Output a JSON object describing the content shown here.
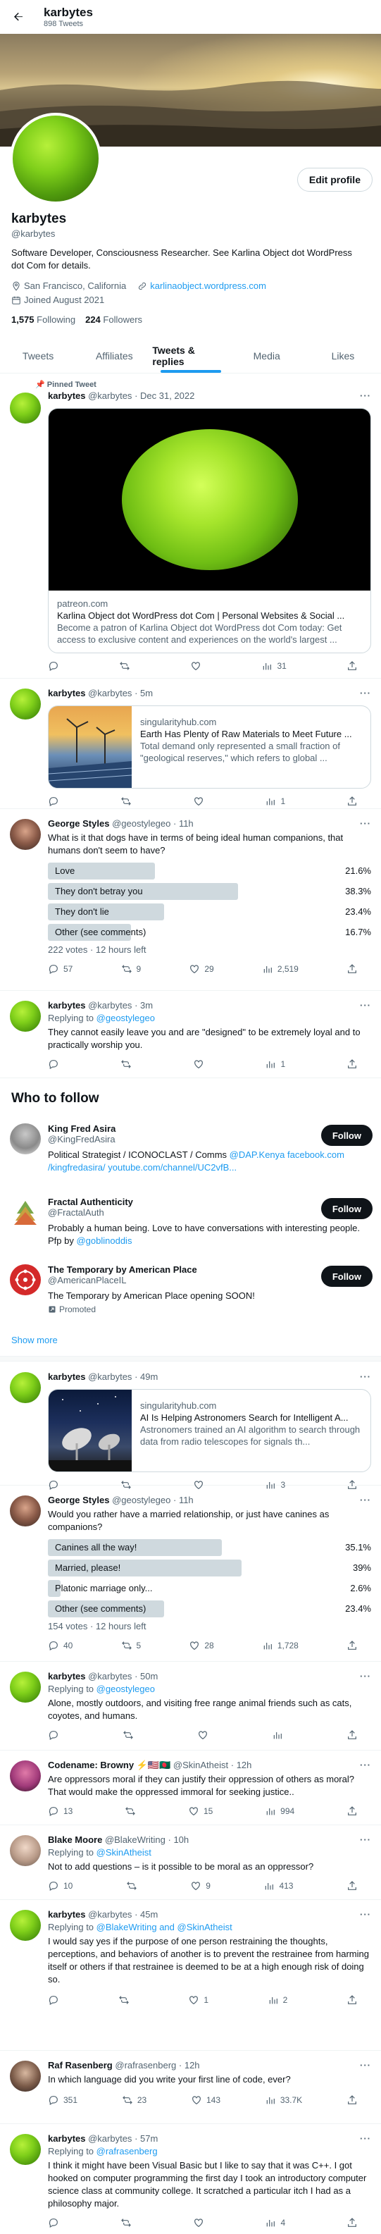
{
  "header": {
    "title": "karbytes",
    "tweet_count": "898 Tweets"
  },
  "profile": {
    "name": "karbytes",
    "handle": "@karbytes",
    "bio": "Software Developer, Consciousness Researcher. See Karlina Object dot WordPress dot Com for details.",
    "location": "San Francisco, California",
    "website": "karlinaobject.wordpress.com",
    "joined": "Joined August 2021",
    "following_count": "1,575",
    "following_label": "Following",
    "followers_count": "224",
    "followers_label": "Followers",
    "edit_label": "Edit profile"
  },
  "tabs": [
    "Tweets",
    "Affiliates",
    "Tweets & replies",
    "Media",
    "Likes"
  ],
  "active_tab": "Tweets & replies",
  "tweets": [
    {
      "pinned_label": "Pinned Tweet",
      "name": "karbytes",
      "handle": "@karbytes",
      "time": "· Dec 31, 2022",
      "card": {
        "domain": "patreon.com",
        "title": "Karlina Object dot WordPress dot Com | Personal Websites & Social ...",
        "desc": "Become a patron of Karlina Object dot WordPress dot Com today: Get access to exclusive content and experiences on the world's largest ..."
      },
      "views": "31"
    },
    {
      "name": "karbytes",
      "handle": "@karbytes",
      "time": "· 5m",
      "card": {
        "domain": "singularityhub.com",
        "title": "Earth Has Plenty of Raw Materials to Meet Future ...",
        "desc": "Total demand only represented a small fraction of \"geological reserves,\" which refers to global ..."
      },
      "likes": "",
      "views": "1"
    },
    {
      "name": "George Styles",
      "handle": "@geostylegeo",
      "time": "· 11h",
      "text": "What is it that dogs have in terms of being ideal human companions, that humans don't seem to have?",
      "poll": [
        {
          "label": "Love",
          "pct": "21.6%",
          "value": 21.6
        },
        {
          "label": "They don't betray you",
          "pct": "38.3%",
          "value": 38.3
        },
        {
          "label": "They don't lie",
          "pct": "23.4%",
          "value": 23.4
        },
        {
          "label": "Other (see comments)",
          "pct": "16.7%",
          "value": 16.7
        }
      ],
      "poll_meta": "222 votes · 12 hours left",
      "replies": "57",
      "retweets": "9",
      "likes": "29",
      "views": "2,519"
    },
    {
      "name": "karbytes",
      "handle": "@karbytes",
      "time": "· 3m",
      "reply_prefix": "Replying to ",
      "reply_to": "@geostylegeo",
      "text": "They cannot easily leave you and are \"designed\" to be extremely loyal and to practically worship you.",
      "views": "1"
    }
  ],
  "who_to_follow": {
    "title": "Who to follow",
    "follow_label": "Follow",
    "show_more": "Show more",
    "items": [
      {
        "name": "King Fred Asira",
        "handle": "@KingFredAsira",
        "bio_pre": "Political Strategist / ICONOCLAST / Comms ",
        "bio_link": "@DAP.Kenya facebook.com /kingfredasira/ youtube.com/channel/UC2vfB..."
      },
      {
        "name": "Fractal Authenticity",
        "handle": "@FractalAuth",
        "bio_pre": "Probably a human being. Love to have conversations with interesting people. Pfp by ",
        "bio_link": "@goblinoddis"
      },
      {
        "name": "The Temporary by American Place",
        "handle": "@AmericanPlaceIL",
        "bio_pre": "The Temporary by American Place opening SOON!",
        "bio_link": "",
        "promoted": "Promoted"
      }
    ]
  },
  "tweets2": [
    {
      "name": "karbytes",
      "handle": "@karbytes",
      "time": "· 49m",
      "card": {
        "domain": "singularityhub.com",
        "title": "AI Is Helping Astronomers Search for Intelligent A...",
        "desc": "Astronomers trained an AI algorithm to search through data from radio telescopes for signals th..."
      },
      "views": "3"
    },
    {
      "name": "George Styles",
      "handle": "@geostylegeo",
      "time": "· 11h",
      "text": "Would you rather have a married relationship, or just have canines as companions?",
      "poll": [
        {
          "label": "Canines all the way!",
          "pct": "35.1%",
          "value": 35.1
        },
        {
          "label": "Married, please!",
          "pct": "39%",
          "value": 39
        },
        {
          "label": "Platonic marriage only...",
          "pct": "2.6%",
          "value": 2.6
        },
        {
          "label": "Other (see comments)",
          "pct": "23.4%",
          "value": 23.4
        }
      ],
      "poll_meta": "154 votes · 12 hours left",
      "replies": "40",
      "retweets": "5",
      "likes": "28",
      "views": "1,728"
    },
    {
      "name": "karbytes",
      "handle": "@karbytes",
      "time": "· 50m",
      "reply_prefix": "Replying to ",
      "reply_to": "@geostylegeo",
      "text": "Alone, mostly outdoors, and visiting free range animal friends such as cats, coyotes, and humans."
    },
    {
      "name": "Codename: Browny",
      "handle": "@SkinAtheist",
      "time": "· 12h",
      "text": "Are oppressors moral if they can justify their oppression of others as moral? That would make the oppressed immoral for seeking justice..",
      "replies": "13",
      "likes": "15",
      "views": "994"
    },
    {
      "name": "Blake Moore",
      "handle": "@BlakeWriting",
      "time": "· 10h",
      "reply_prefix": "Replying to ",
      "reply_to": "@SkinAtheist",
      "text": "Not to add questions – is it possible to be moral as an oppressor?",
      "replies": "10",
      "likes": "9",
      "views": "413"
    },
    {
      "name": "karbytes",
      "handle": "@karbytes",
      "time": "· 45m",
      "reply_prefix": "Replying to ",
      "reply_to": "@BlakeWriting and @SkinAtheist",
      "text": "I would say yes if the purpose of one person restraining the thoughts, perceptions, and behaviors of another is to prevent the restrainee from harming itself or others if that restrainee is deemed to be at a high enough risk of doing so.",
      "likes": "1",
      "views": "2"
    },
    {
      "name": "Raf Rasenberg",
      "handle": "@rafrasenberg",
      "time": "· 12h",
      "text": "In which language did you write your first line of code, ever?",
      "replies": "351",
      "retweets": "23",
      "likes": "143",
      "views": "33.7K"
    },
    {
      "name": "karbytes",
      "handle": "@karbytes",
      "time": "· 57m",
      "reply_prefix": "Replying to ",
      "reply_to": "@rafrasenberg",
      "text": "I think it might have been Visual Basic but I like to say that it was C++. I got hooked on computer programming the first day I took an introductory computer science class at community college. It scratched a particular itch I had as a philosophy major.",
      "likes": "",
      "views": "4"
    }
  ]
}
